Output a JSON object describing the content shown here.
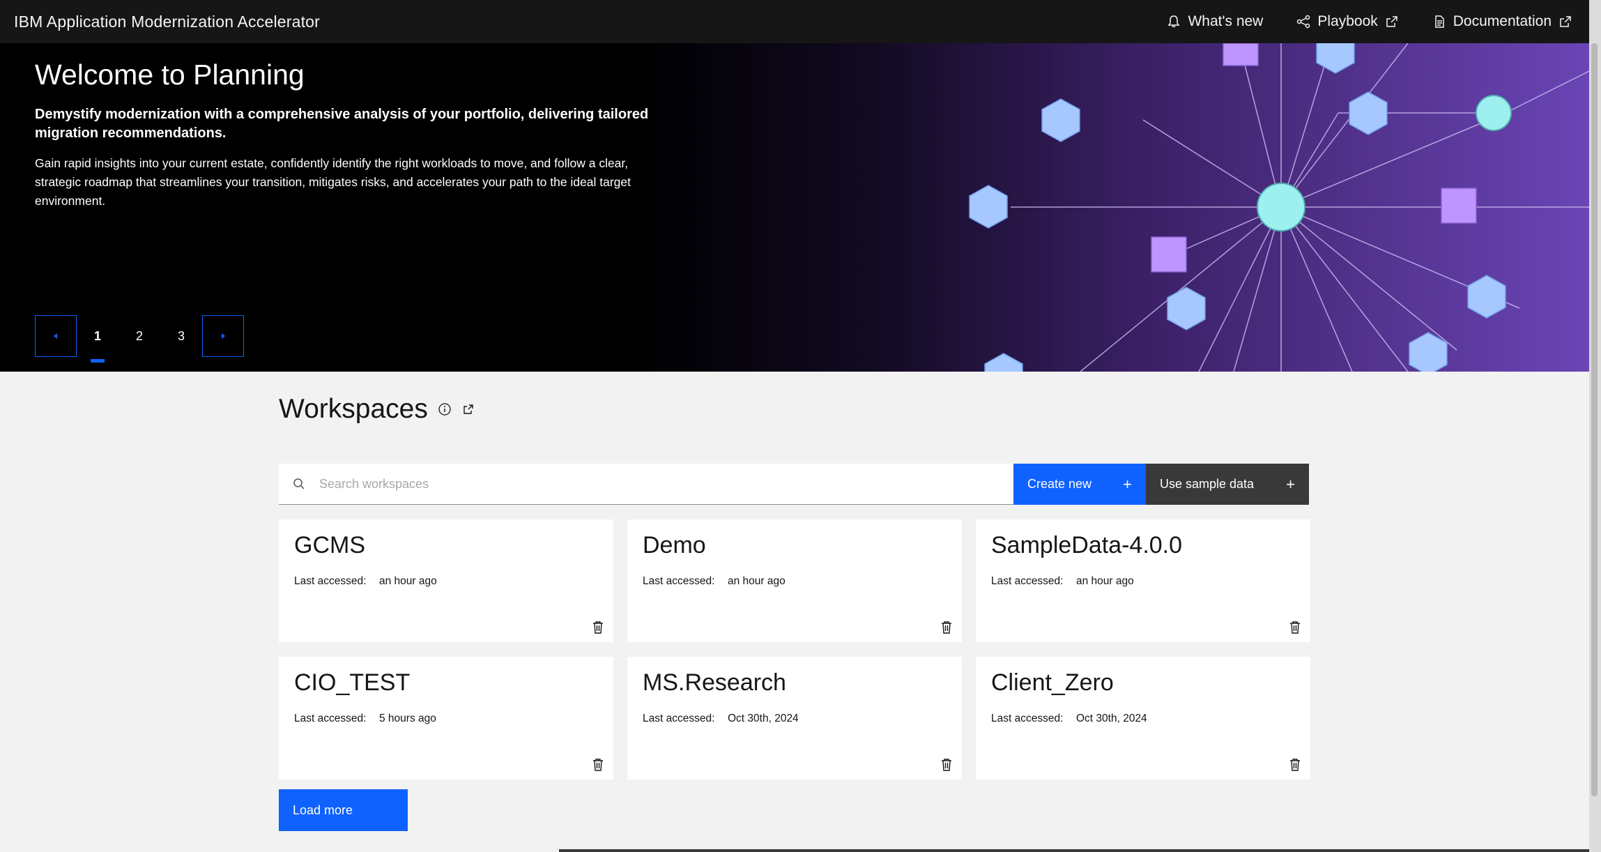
{
  "header": {
    "app_title": "IBM Application Modernization Accelerator",
    "nav": [
      {
        "label": "What's new",
        "icon": "bell-icon"
      },
      {
        "label": "Playbook",
        "icon": "flow-icon",
        "external": true
      },
      {
        "label": "Documentation",
        "icon": "document-icon",
        "external": true
      }
    ]
  },
  "hero": {
    "title": "Welcome to Planning",
    "subtitle": "Demystify modernization with a comprehensive analysis of your portfolio, delivering tailored migration recommendations.",
    "body": "Gain rapid insights into your current estate, confidently identify the right workloads to move, and follow a clear, strategic roadmap that streamlines your transition, mitigates risks, and accelerates your path to the ideal target environment.",
    "pager": {
      "pages": [
        "1",
        "2",
        "3"
      ],
      "current": "1"
    },
    "colors": {
      "hex_blue": "#a6c8ff",
      "circle_teal": "#9ef0f0",
      "square_purple": "#be95ff"
    }
  },
  "workspaces": {
    "title": "Workspaces",
    "search_placeholder": "Search workspaces",
    "create_label": "Create new",
    "sample_label": "Use sample data",
    "last_accessed_label": "Last accessed:",
    "items": [
      {
        "name": "GCMS",
        "last_accessed": "an hour ago"
      },
      {
        "name": "Demo",
        "last_accessed": "an hour ago"
      },
      {
        "name": "SampleData-4.0.0",
        "last_accessed": "an hour ago"
      },
      {
        "name": "CIO_TEST",
        "last_accessed": "5 hours ago"
      },
      {
        "name": "MS.Research",
        "last_accessed": "Oct 30th, 2024"
      },
      {
        "name": "Client_Zero",
        "last_accessed": "Oct 30th, 2024"
      }
    ],
    "load_more_label": "Load more"
  },
  "colors": {
    "primary": "#0f62fe",
    "header_bg": "#161616",
    "secondary_button": "#393939"
  }
}
